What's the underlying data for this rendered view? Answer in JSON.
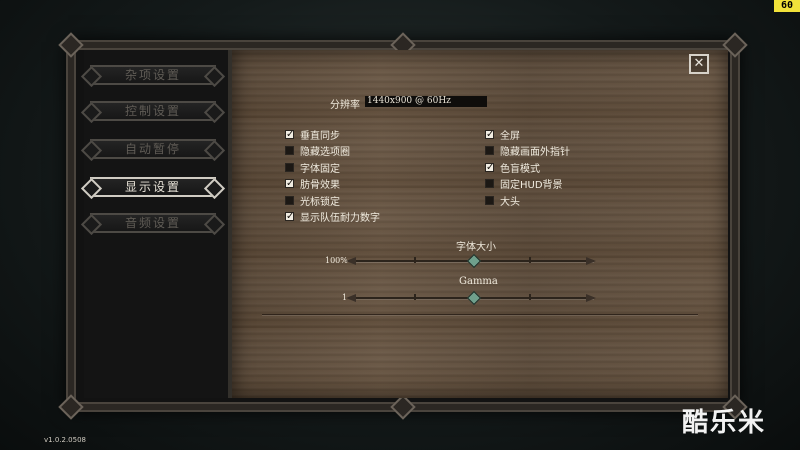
{
  "fps_counter": "60",
  "nav": {
    "items": [
      {
        "label": "杂项设置"
      },
      {
        "label": "控制设置"
      },
      {
        "label": "自动暂停"
      },
      {
        "label": "显示设置"
      },
      {
        "label": "音频设置"
      }
    ]
  },
  "close_label": "✕",
  "display": {
    "resolution_label": "分辨率",
    "resolution_value": "1440x900 @ 60Hz",
    "options_left": [
      {
        "label": "垂直同步",
        "checked": true
      },
      {
        "label": "隐藏选项圈",
        "checked": false
      },
      {
        "label": "字体固定",
        "checked": false
      },
      {
        "label": "肪骨效果",
        "checked": true
      },
      {
        "label": "光标锁定",
        "checked": false
      },
      {
        "label": "显示队伍耐力数字",
        "checked": true
      }
    ],
    "options_right": [
      {
        "label": "全屏",
        "checked": true
      },
      {
        "label": "隐藏画面外指针",
        "checked": false
      },
      {
        "label": "色盲模式",
        "checked": true
      },
      {
        "label": "固定HUD背景",
        "checked": false
      },
      {
        "label": "大头",
        "checked": false
      }
    ],
    "font_size": {
      "title": "字体大小",
      "value_label": "100%",
      "level": 0.5
    },
    "gamma": {
      "title": "Gamma",
      "value_label": "1",
      "level": 0.5
    }
  },
  "version": "v1.0.2.0508",
  "watermark": "酷乐米",
  "check_glyph": "✓"
}
